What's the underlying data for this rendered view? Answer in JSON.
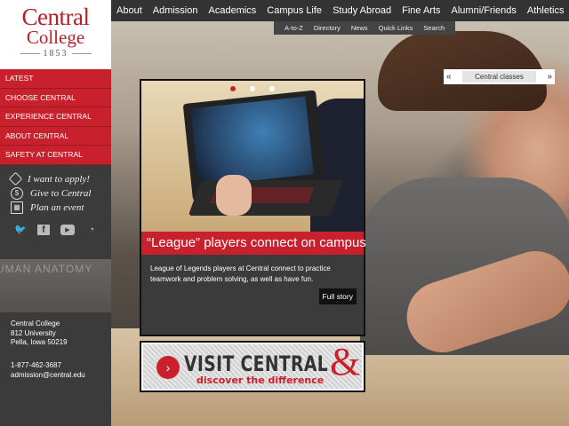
{
  "logo": {
    "line1": "Central",
    "line2": "College",
    "year": "1853"
  },
  "topnav": [
    "About",
    "Admission",
    "Academics",
    "Campus Life",
    "Study Abroad",
    "Fine Arts",
    "Alumni/Friends",
    "Athletics"
  ],
  "subnav": [
    "A-to-Z",
    "Directory",
    "News",
    "Quick Links",
    "Search"
  ],
  "sidebar_menu": [
    "LATEST",
    "CHOOSE CENTRAL",
    "EXPERIENCE CENTRAL",
    "ABOUT CENTRAL",
    "SAFETY AT CENTRAL"
  ],
  "quick_links": [
    {
      "label": "I want to apply!",
      "icon": "apply-icon"
    },
    {
      "label": "Give to Central",
      "icon": "dollar-icon"
    },
    {
      "label": "Plan an event",
      "icon": "calendar-icon"
    }
  ],
  "social_icons": [
    "twitter-icon",
    "facebook-icon",
    "youtube-icon",
    "rss-icon"
  ],
  "background_sign": "UMAN ANATOMY",
  "address": {
    "name": "Central College",
    "street": "812 University",
    "city": "Pella, Iowa 50219"
  },
  "contact": {
    "phone": "1-877-462-3687",
    "email": "admission@central.edu"
  },
  "carousel": {
    "headline": "“League” players connect on campus",
    "description": "League of Legends players at Central connect to practice teamwork and problem solving, as well as have fun.",
    "button": "Full story",
    "active_slide": 1,
    "slide_count": 3
  },
  "visit_banner": {
    "title": "VISIT CENTRAL",
    "amp": "&",
    "subtitle": "discover the difference"
  },
  "photo_tag": {
    "label": "Central classes",
    "prev": "«",
    "next": "»"
  },
  "colors": {
    "brand_red": "#c8202c",
    "nav_bg": "#333333",
    "sidebar_bg": "#3b3b3b"
  }
}
